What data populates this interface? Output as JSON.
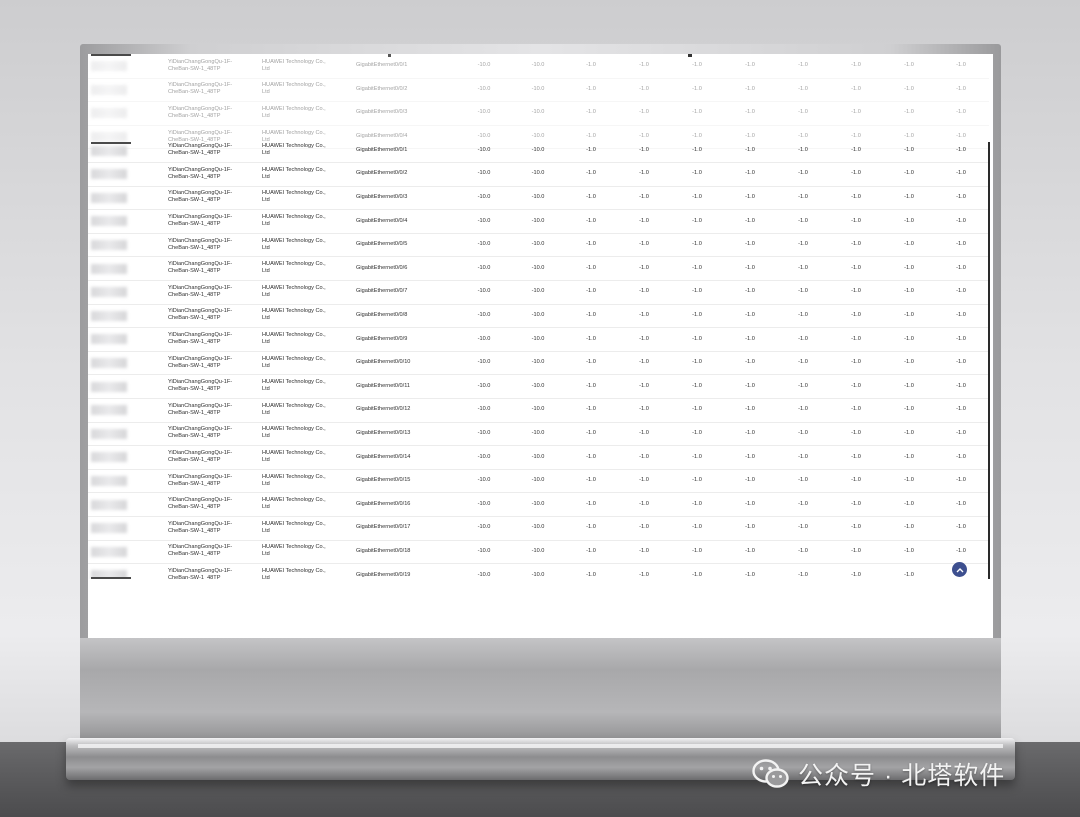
{
  "table": {
    "ghost_rows": [
      {
        "device": [
          "YiDianChangGongQu-1F-",
          "CheBan-SW-1_48TP"
        ],
        "vendor": [
          "HUAWEI Technology Co.,",
          "Ltd"
        ],
        "port": "GigabitEthernet0/0/1",
        "values": [
          "-10.0",
          "-10.0",
          "-1.0",
          "-1.0",
          "-1.0",
          "-1.0",
          "-1.0",
          "-1.0",
          "-1.0",
          "-1.0"
        ]
      },
      {
        "device": [
          "YiDianChangGongQu-1F-",
          "CheBan-SW-1_48TP"
        ],
        "vendor": [
          "HUAWEI Technology Co.,",
          "Ltd"
        ],
        "port": "GigabitEthernet0/0/2",
        "values": [
          "-10.0",
          "-10.0",
          "-1.0",
          "-1.0",
          "-1.0",
          "-1.0",
          "-1.0",
          "-1.0",
          "-1.0",
          "-1.0"
        ]
      },
      {
        "device": [
          "YiDianChangGongQu-1F-",
          "CheBan-SW-1_48TP"
        ],
        "vendor": [
          "HUAWEI Technology Co.,",
          "Ltd"
        ],
        "port": "GigabitEthernet0/0/3",
        "values": [
          "-10.0",
          "-10.0",
          "-1.0",
          "-1.0",
          "-1.0",
          "-1.0",
          "-1.0",
          "-1.0",
          "-1.0",
          "-1.0"
        ]
      },
      {
        "device": [
          "YiDianChangGongQu-1F-",
          "CheBan-SW-1_48TP"
        ],
        "vendor": [
          "HUAWEI Technology Co.,",
          "Ltd"
        ],
        "port": "GigabitEthernet0/0/4",
        "values": [
          "-10.0",
          "-10.0",
          "-1.0",
          "-1.0",
          "-1.0",
          "-1.0",
          "-1.0",
          "-1.0",
          "-1.0",
          "-1.0"
        ]
      }
    ],
    "rows": [
      {
        "device": [
          "YiDianChangGongQu-1F-",
          "CheBan-SW-1_48TP"
        ],
        "vendor": [
          "HUAWEI Technology Co.,",
          "Ltd"
        ],
        "port": "GigabitEthernet0/0/1",
        "values": [
          "-10.0",
          "-10.0",
          "-1.0",
          "-1.0",
          "-1.0",
          "-1.0",
          "-1.0",
          "-1.0",
          "-1.0",
          "-1.0"
        ]
      },
      {
        "device": [
          "YiDianChangGongQu-1F-",
          "CheBan-SW-1_48TP"
        ],
        "vendor": [
          "HUAWEI Technology Co.,",
          "Ltd"
        ],
        "port": "GigabitEthernet0/0/2",
        "values": [
          "-10.0",
          "-10.0",
          "-1.0",
          "-1.0",
          "-1.0",
          "-1.0",
          "-1.0",
          "-1.0",
          "-1.0",
          "-1.0"
        ]
      },
      {
        "device": [
          "YiDianChangGongQu-1F-",
          "CheBan-SW-1_48TP"
        ],
        "vendor": [
          "HUAWEI Technology Co.,",
          "Ltd"
        ],
        "port": "GigabitEthernet0/0/3",
        "values": [
          "-10.0",
          "-10.0",
          "-1.0",
          "-1.0",
          "-1.0",
          "-1.0",
          "-1.0",
          "-1.0",
          "-1.0",
          "-1.0"
        ]
      },
      {
        "device": [
          "YiDianChangGongQu-1F-",
          "CheBan-SW-1_48TP"
        ],
        "vendor": [
          "HUAWEI Technology Co.,",
          "Ltd"
        ],
        "port": "GigabitEthernet0/0/4",
        "values": [
          "-10.0",
          "-10.0",
          "-1.0",
          "-1.0",
          "-1.0",
          "-1.0",
          "-1.0",
          "-1.0",
          "-1.0",
          "-1.0"
        ]
      },
      {
        "device": [
          "YiDianChangGongQu-1F-",
          "CheBan-SW-1_48TP"
        ],
        "vendor": [
          "HUAWEI Technology Co.,",
          "Ltd"
        ],
        "port": "GigabitEthernet0/0/5",
        "values": [
          "-10.0",
          "-10.0",
          "-1.0",
          "-1.0",
          "-1.0",
          "-1.0",
          "-1.0",
          "-1.0",
          "-1.0",
          "-1.0"
        ]
      },
      {
        "device": [
          "YiDianChangGongQu-1F-",
          "CheBan-SW-1_48TP"
        ],
        "vendor": [
          "HUAWEI Technology Co.,",
          "Ltd"
        ],
        "port": "GigabitEthernet0/0/6",
        "values": [
          "-10.0",
          "-10.0",
          "-1.0",
          "-1.0",
          "-1.0",
          "-1.0",
          "-1.0",
          "-1.0",
          "-1.0",
          "-1.0"
        ]
      },
      {
        "device": [
          "YiDianChangGongQu-1F-",
          "CheBan-SW-1_48TP"
        ],
        "vendor": [
          "HUAWEI Technology Co.,",
          "Ltd"
        ],
        "port": "GigabitEthernet0/0/7",
        "values": [
          "-10.0",
          "-10.0",
          "-1.0",
          "-1.0",
          "-1.0",
          "-1.0",
          "-1.0",
          "-1.0",
          "-1.0",
          "-1.0"
        ]
      },
      {
        "device": [
          "YiDianChangGongQu-1F-",
          "CheBan-SW-1_48TP"
        ],
        "vendor": [
          "HUAWEI Technology Co.,",
          "Ltd"
        ],
        "port": "GigabitEthernet0/0/8",
        "values": [
          "-10.0",
          "-10.0",
          "-1.0",
          "-1.0",
          "-1.0",
          "-1.0",
          "-1.0",
          "-1.0",
          "-1.0",
          "-1.0"
        ]
      },
      {
        "device": [
          "YiDianChangGongQu-1F-",
          "CheBan-SW-1_48TP"
        ],
        "vendor": [
          "HUAWEI Technology Co.,",
          "Ltd"
        ],
        "port": "GigabitEthernet0/0/9",
        "values": [
          "-10.0",
          "-10.0",
          "-1.0",
          "-1.0",
          "-1.0",
          "-1.0",
          "-1.0",
          "-1.0",
          "-1.0",
          "-1.0"
        ]
      },
      {
        "device": [
          "YiDianChangGongQu-1F-",
          "CheBan-SW-1_48TP"
        ],
        "vendor": [
          "HUAWEI Technology Co.,",
          "Ltd"
        ],
        "port": "GigabitEthernet0/0/10",
        "values": [
          "-10.0",
          "-10.0",
          "-1.0",
          "-1.0",
          "-1.0",
          "-1.0",
          "-1.0",
          "-1.0",
          "-1.0",
          "-1.0"
        ]
      },
      {
        "device": [
          "YiDianChangGongQu-1F-",
          "CheBan-SW-1_48TP"
        ],
        "vendor": [
          "HUAWEI Technology Co.,",
          "Ltd"
        ],
        "port": "GigabitEthernet0/0/11",
        "values": [
          "-10.0",
          "-10.0",
          "-1.0",
          "-1.0",
          "-1.0",
          "-1.0",
          "-1.0",
          "-1.0",
          "-1.0",
          "-1.0"
        ]
      },
      {
        "device": [
          "YiDianChangGongQu-1F-",
          "CheBan-SW-1_48TP"
        ],
        "vendor": [
          "HUAWEI Technology Co.,",
          "Ltd"
        ],
        "port": "GigabitEthernet0/0/12",
        "values": [
          "-10.0",
          "-10.0",
          "-1.0",
          "-1.0",
          "-1.0",
          "-1.0",
          "-1.0",
          "-1.0",
          "-1.0",
          "-1.0"
        ]
      },
      {
        "device": [
          "YiDianChangGongQu-1F-",
          "CheBan-SW-1_48TP"
        ],
        "vendor": [
          "HUAWEI Technology Co.,",
          "Ltd"
        ],
        "port": "GigabitEthernet0/0/13",
        "values": [
          "-10.0",
          "-10.0",
          "-1.0",
          "-1.0",
          "-1.0",
          "-1.0",
          "-1.0",
          "-1.0",
          "-1.0",
          "-1.0"
        ]
      },
      {
        "device": [
          "YiDianChangGongQu-1F-",
          "CheBan-SW-1_48TP"
        ],
        "vendor": [
          "HUAWEI Technology Co.,",
          "Ltd"
        ],
        "port": "GigabitEthernet0/0/14",
        "values": [
          "-10.0",
          "-10.0",
          "-1.0",
          "-1.0",
          "-1.0",
          "-1.0",
          "-1.0",
          "-1.0",
          "-1.0",
          "-1.0"
        ]
      },
      {
        "device": [
          "YiDianChangGongQu-1F-",
          "CheBan-SW-1_48TP"
        ],
        "vendor": [
          "HUAWEI Technology Co.,",
          "Ltd"
        ],
        "port": "GigabitEthernet0/0/15",
        "values": [
          "-10.0",
          "-10.0",
          "-1.0",
          "-1.0",
          "-1.0",
          "-1.0",
          "-1.0",
          "-1.0",
          "-1.0",
          "-1.0"
        ]
      },
      {
        "device": [
          "YiDianChangGongQu-1F-",
          "CheBan-SW-1_48TP"
        ],
        "vendor": [
          "HUAWEI Technology Co.,",
          "Ltd"
        ],
        "port": "GigabitEthernet0/0/16",
        "values": [
          "-10.0",
          "-10.0",
          "-1.0",
          "-1.0",
          "-1.0",
          "-1.0",
          "-1.0",
          "-1.0",
          "-1.0",
          "-1.0"
        ]
      },
      {
        "device": [
          "YiDianChangGongQu-1F-",
          "CheBan-SW-1_48TP"
        ],
        "vendor": [
          "HUAWEI Technology Co.,",
          "Ltd"
        ],
        "port": "GigabitEthernet0/0/17",
        "values": [
          "-10.0",
          "-10.0",
          "-1.0",
          "-1.0",
          "-1.0",
          "-1.0",
          "-1.0",
          "-1.0",
          "-1.0",
          "-1.0"
        ]
      },
      {
        "device": [
          "YiDianChangGongQu-1F-",
          "CheBan-SW-1_48TP"
        ],
        "vendor": [
          "HUAWEI Technology Co.,",
          "Ltd"
        ],
        "port": "GigabitEthernet0/0/18",
        "values": [
          "-10.0",
          "-10.0",
          "-1.0",
          "-1.0",
          "-1.0",
          "-1.0",
          "-1.0",
          "-1.0",
          "-1.0",
          "-1.0"
        ]
      },
      {
        "device": [
          "YiDianChangGongQu-1F-",
          "CheBan-SW-1_48TP"
        ],
        "vendor": [
          "HUAWEI Technology Co.,",
          "Ltd"
        ],
        "port": "GigabitEthernet0/0/19",
        "values": [
          "-10.0",
          "-10.0",
          "-1.0",
          "-1.0",
          "-1.0",
          "-1.0",
          "-1.0",
          "-1.0",
          "-1.0"
        ]
      }
    ]
  },
  "back_to_top": {
    "icon": "chevron-up-icon",
    "color": "#3d4f8f"
  },
  "watermark": {
    "icon": "wechat-icon",
    "text": "公众号 · 北塔软件"
  },
  "colors": {
    "screen": "#ffffff",
    "row_divider": "#ececec",
    "text": "#2e2e2e"
  }
}
